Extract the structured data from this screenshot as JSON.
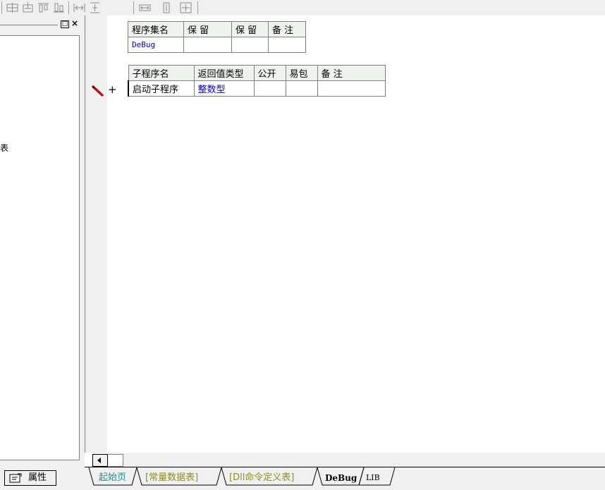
{
  "toolbar": {
    "icons": [
      "align-horizontal-center-icon",
      "align-vertical-center-icon",
      "align-top-icon",
      "align-bottom-icon",
      "space-horizontal-icon",
      "space-vertical-icon",
      "same-width-icon",
      "same-height-icon",
      "same-size-icon"
    ]
  },
  "left_panel": {
    "restore_glyph": "□",
    "close_glyph": "×",
    "fragment_text": "表",
    "properties_tab_label": "属性"
  },
  "assembly_table": {
    "headers": [
      "程序集名",
      "保 留",
      "保 留",
      "备 注"
    ],
    "row": [
      "DeBug",
      "",
      "",
      ""
    ]
  },
  "sub_table": {
    "headers": [
      "子程序名",
      "返回值类型",
      "公开",
      "易包",
      "备 注"
    ],
    "row": [
      "启动子程序",
      "整数型",
      "",
      "",
      ""
    ]
  },
  "editor": {
    "plus_sign": "+"
  },
  "tabs": [
    {
      "label": "起始页"
    },
    {
      "label": "[常量数据表]"
    },
    {
      "label": "[Dll命令定义表]"
    },
    {
      "label": "DeBug"
    },
    {
      "label": "LIB"
    }
  ],
  "colors": {
    "blue_text": "#0000e0",
    "header_bg": "#eef3ee",
    "pencil": "#b01818"
  }
}
